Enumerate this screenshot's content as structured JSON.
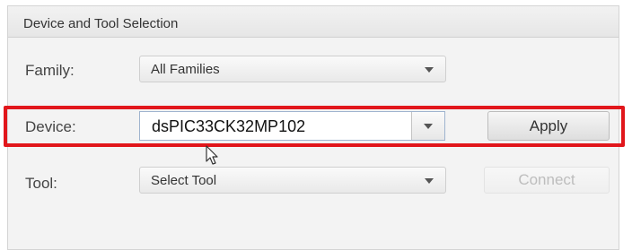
{
  "panel": {
    "title": "Device and Tool Selection"
  },
  "family": {
    "label": "Family:",
    "value": "All Families",
    "icon": "chevron-down-icon"
  },
  "device": {
    "label": "Device:",
    "value": "dsPIC33CK32MP102",
    "icon": "chevron-down-icon"
  },
  "apply": {
    "label": "Apply"
  },
  "tool": {
    "label": "Tool:",
    "value": "Select Tool",
    "icon": "chevron-down-icon"
  },
  "connect": {
    "label": "Connect",
    "enabled": false
  },
  "annotation": {
    "color": "#e1161b"
  }
}
